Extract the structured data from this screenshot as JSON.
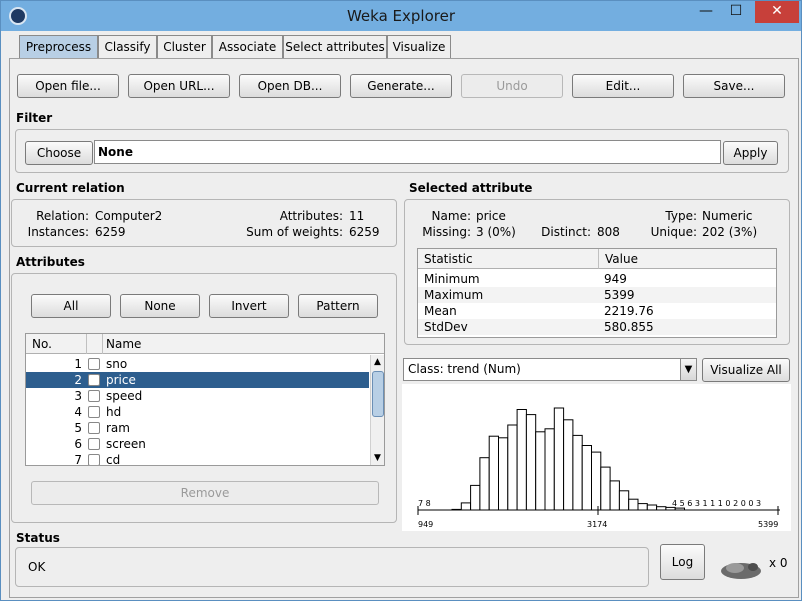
{
  "window": {
    "title": "Weka Explorer",
    "min": "—",
    "max": "☐",
    "close": "✕"
  },
  "tabs": [
    {
      "label": "Preprocess"
    },
    {
      "label": "Classify"
    },
    {
      "label": "Cluster"
    },
    {
      "label": "Associate"
    },
    {
      "label": "Select attributes"
    },
    {
      "label": "Visualize"
    }
  ],
  "toolbar": {
    "open_file": "Open file...",
    "open_url": "Open URL...",
    "open_db": "Open DB...",
    "generate": "Generate...",
    "undo": "Undo",
    "edit": "Edit...",
    "save": "Save..."
  },
  "filter": {
    "label": "Filter",
    "choose": "Choose",
    "value": "None",
    "apply": "Apply"
  },
  "relation": {
    "label": "Current relation",
    "relation_key": "Relation:",
    "relation_val": "Computer2",
    "instances_key": "Instances:",
    "instances_val": "6259",
    "attributes_key": "Attributes:",
    "attributes_val": "11",
    "sow_key": "Sum of weights:",
    "sow_val": "6259"
  },
  "attributes": {
    "label": "Attributes",
    "btn_all": "All",
    "btn_none": "None",
    "btn_invert": "Invert",
    "btn_pattern": "Pattern",
    "col_no": "No.",
    "col_name": "Name",
    "rows": [
      {
        "no": "1",
        "name": "sno"
      },
      {
        "no": "2",
        "name": "price"
      },
      {
        "no": "3",
        "name": "speed"
      },
      {
        "no": "4",
        "name": "hd"
      },
      {
        "no": "5",
        "name": "ram"
      },
      {
        "no": "6",
        "name": "screen"
      },
      {
        "no": "7",
        "name": "cd"
      }
    ],
    "remove": "Remove"
  },
  "selected": {
    "label": "Selected attribute",
    "name_key": "Name:",
    "name_val": "price",
    "type_key": "Type:",
    "type_val": "Numeric",
    "missing_key": "Missing:",
    "missing_val": "3 (0%)",
    "distinct_key": "Distinct:",
    "distinct_val": "808",
    "unique_key": "Unique:",
    "unique_val": "202 (3%)",
    "col_stat": "Statistic",
    "col_value": "Value",
    "rows": [
      {
        "stat": "Minimum",
        "value": "949"
      },
      {
        "stat": "Maximum",
        "value": "5399"
      },
      {
        "stat": "Mean",
        "value": "2219.76"
      },
      {
        "stat": "StdDev",
        "value": "580.855"
      }
    ]
  },
  "class_select": {
    "value": "Class: trend (Num)",
    "visualize_all": "Visualize All"
  },
  "histogram": {
    "x_min": "949",
    "x_mid": "3174",
    "x_max": "5399",
    "left_counts": "7 8",
    "right_counts": "4 5 6 3 1 1 1 0 2 0 0 3",
    "bars": [
      0.4,
      5.1,
      17.8,
      37.8,
      53.3,
      52.2,
      61.4,
      72.6,
      68.9,
      56.5,
      58.7,
      73.7,
      65.2,
      53.9,
      46.6,
      41.8,
      31.0,
      21.0,
      13.9,
      7.8,
      4.6,
      3.6,
      2.4,
      1.9,
      1.4
    ]
  },
  "status": {
    "label": "Status",
    "text": "OK",
    "log": "Log",
    "count": "x 0"
  }
}
